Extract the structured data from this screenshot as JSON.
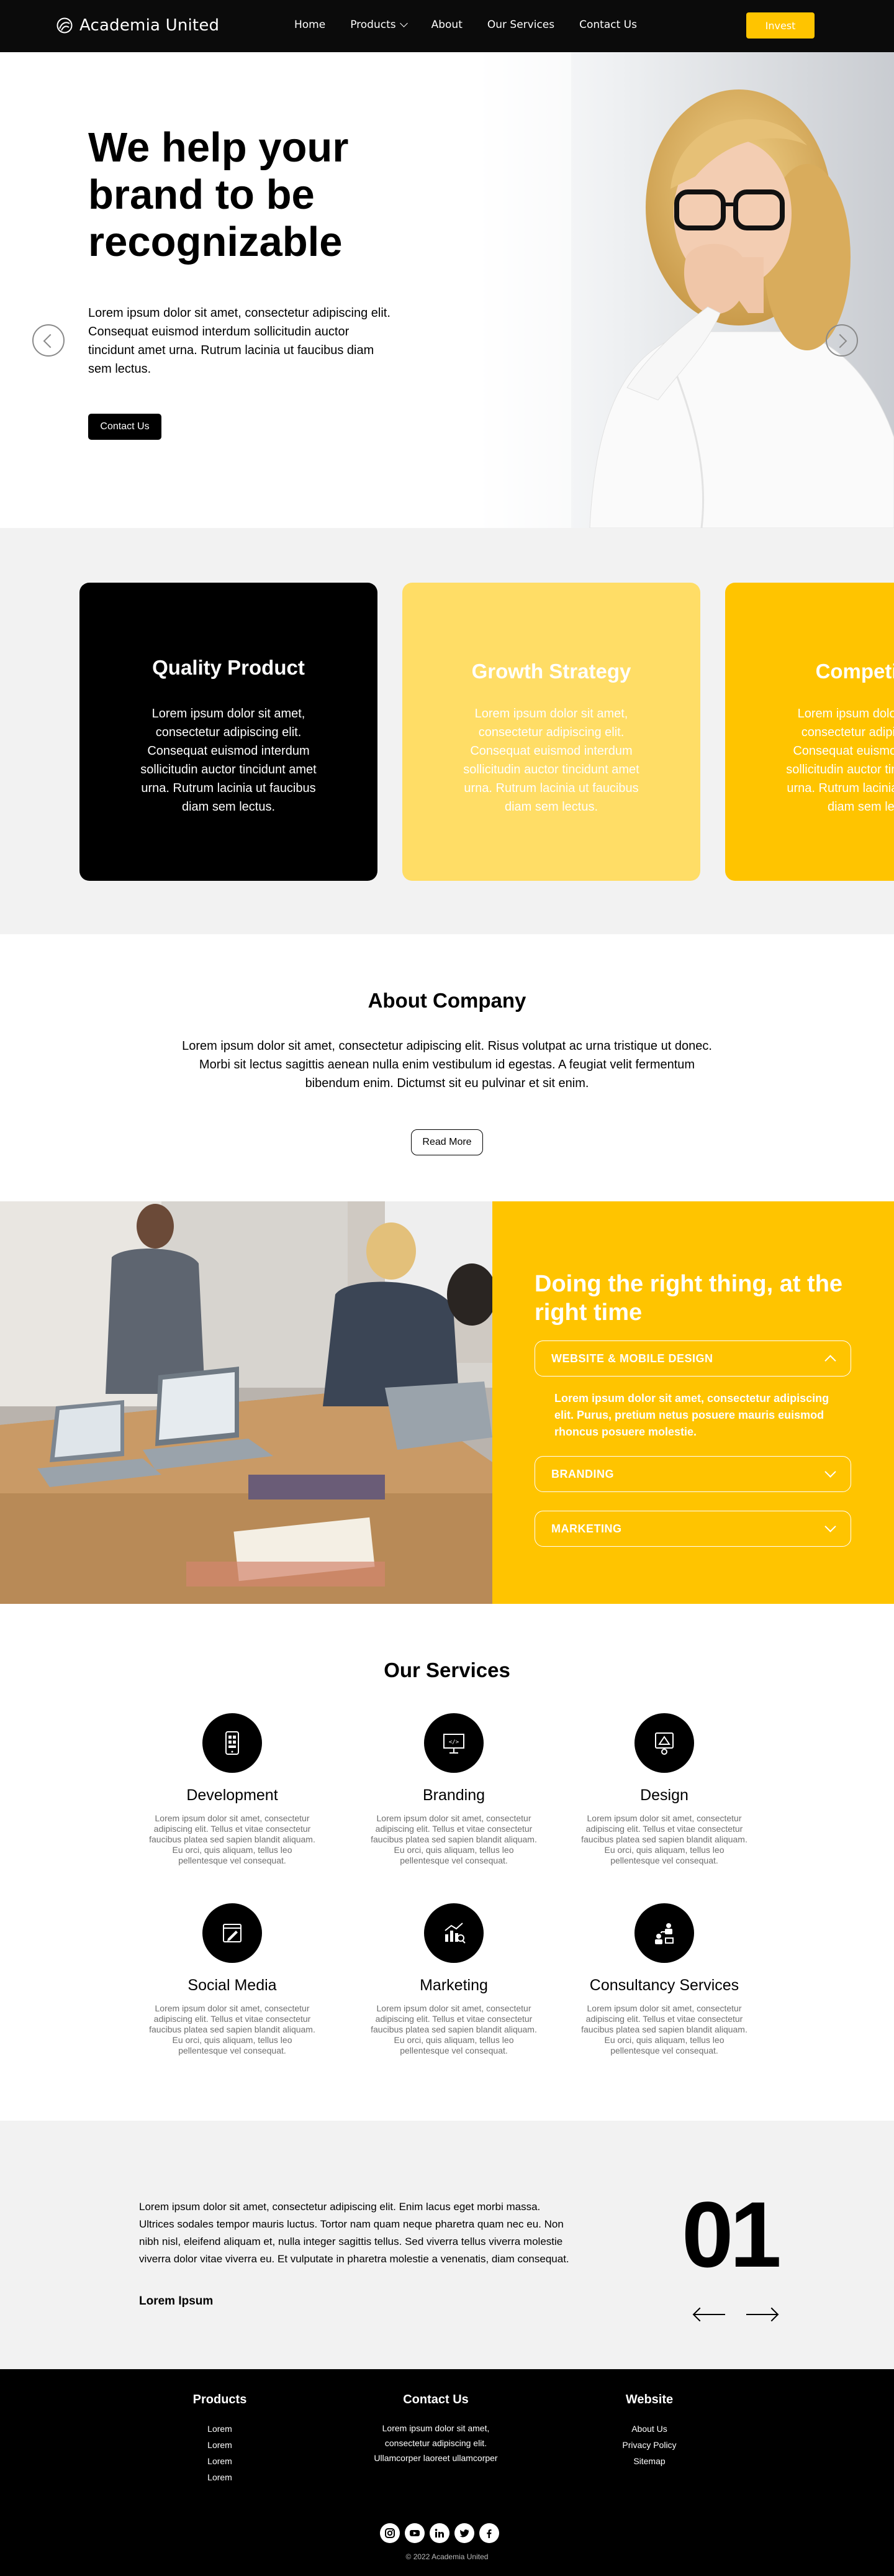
{
  "nav": {
    "brand": "Academia United",
    "links": [
      "Home",
      "Products",
      "About",
      "Our Services",
      "Contact Us"
    ],
    "cta": "Invest"
  },
  "hero": {
    "title": "We help your brand to be recognizable",
    "text": "Lorem ipsum dolor sit amet, consectetur adipiscing elit. Consequat euismod interdum sollicitudin auctor tincidunt amet urna. Rutrum lacinia ut faucibus diam sem lectus.",
    "cta": "Contact Us"
  },
  "features": [
    {
      "title": "Quality Product",
      "text": "Lorem ipsum dolor sit amet, consectetur adipiscing elit. Consequat euismod interdum sollicitudin auctor tincidunt amet urna. Rutrum lacinia ut faucibus diam sem lectus."
    },
    {
      "title": "Growth Strategy",
      "text": "Lorem ipsum dolor sit amet, consectetur adipiscing elit. Consequat euismod interdum sollicitudin auctor tincidunt amet urna. Rutrum lacinia ut faucibus diam sem lectus."
    },
    {
      "title": "Competitive",
      "text": "Lorem ipsum dolor sit amet, consectetur adipiscing elit. Consequat euismod interdum sollicitudin auctor tincidunt amet urna. Rutrum lacinia ut faucibus diam sem lectus."
    }
  ],
  "about": {
    "title": "About Company",
    "text": "Lorem ipsum dolor sit amet, consectetur adipiscing elit. Risus volutpat ac urna tristique ut donec. Morbi sit lectus sagittis aenean nulla enim vestibulum id egestas. A feugiat velit fermentum bibendum enim. Dictumst sit eu pulvinar et sit enim.",
    "cta": "Read More"
  },
  "right_time": {
    "title": "Doing the right thing, at the right time",
    "accordion": [
      {
        "label": "WEBSITE & MOBILE DESIGN",
        "body": "Lorem ipsum dolor sit amet, consectetur adipiscing elit. Purus, pretium netus posuere mauris euismod rhoncus posuere molestie."
      },
      {
        "label": "BRANDING"
      },
      {
        "label": "MARKETING"
      }
    ]
  },
  "services": {
    "title": "Our Services",
    "items": [
      {
        "name": "Development",
        "icon": "mobile-app-icon",
        "text": "Lorem ipsum dolor sit amet, consectetur adipiscing elit. Tellus et vitae consectetur faucibus platea sed sapien blandit aliquam. Eu orci, quis aliquam, tellus leo pellentesque vel consequat."
      },
      {
        "name": "Branding",
        "icon": "presentation-icon",
        "text": "Lorem ipsum dolor sit amet, consectetur adipiscing elit. Tellus et vitae consectetur faucibus platea sed sapien blandit aliquam. Eu orci, quis aliquam, tellus leo pellentesque vel consequat."
      },
      {
        "name": "Design",
        "icon": "design-icon",
        "text": "Lorem ipsum dolor sit amet, consectetur adipiscing elit. Tellus et vitae consectetur faucibus platea sed sapien blandit aliquam. Eu orci, quis aliquam, tellus leo pellentesque vel consequat."
      },
      {
        "name": "Social Media",
        "icon": "edit-icon",
        "text": "Lorem ipsum dolor sit amet, consectetur adipiscing elit. Tellus et vitae consectetur faucibus platea sed sapien blandit aliquam. Eu orci, quis aliquam, tellus leo pellentesque vel consequat."
      },
      {
        "name": "Marketing",
        "icon": "growth-chart-icon",
        "text": "Lorem ipsum dolor sit amet, consectetur adipiscing elit. Tellus et vitae consectetur faucibus platea sed sapien blandit aliquam. Eu orci, quis aliquam, tellus leo pellentesque vel consequat."
      },
      {
        "name": "Consultancy Services",
        "icon": "consultancy-icon",
        "text": "Lorem ipsum dolor sit amet, consectetur adipiscing elit. Tellus et vitae consectetur faucibus platea sed sapien blandit aliquam. Eu orci, quis aliquam, tellus leo pellentesque vel consequat."
      }
    ]
  },
  "testimonial": {
    "text": "Lorem ipsum dolor sit amet, consectetur adipiscing elit. Enim lacus eget morbi massa. Ultrices sodales tempor mauris luctus. Tortor nam quam neque pharetra quam nec eu. Non nibh nisl, eleifend aliquam et, nulla integer sagittis tellus. Sed viverra tellus viverra molestie viverra dolor vitae viverra eu. Et vulputate in pharetra molestie a venenatis, diam consequat.",
    "author": "Lorem Ipsum",
    "number": "01"
  },
  "footer": {
    "products": {
      "title": "Products",
      "items": [
        "Lorem",
        "Lorem",
        "Lorem",
        "Lorem"
      ]
    },
    "contact": {
      "title": "Contact Us",
      "lines": [
        "Lorem ipsum dolor sit amet,",
        "consectetur adipiscing elit.",
        "Ullamcorper laoreet ullamcorper"
      ]
    },
    "website": {
      "title": "Website",
      "items": [
        "About Us",
        "Privacy Policy",
        "Sitemap"
      ]
    },
    "social": [
      "instagram-icon",
      "youtube-icon",
      "linkedin-icon",
      "twitter-icon",
      "facebook-icon"
    ],
    "copyright": "© 2022 Academia United"
  },
  "colors": {
    "accent": "#ffc400",
    "accent_light": "#ffdd66",
    "dark": "#000000",
    "panel_bg": "#f2f2f2"
  }
}
